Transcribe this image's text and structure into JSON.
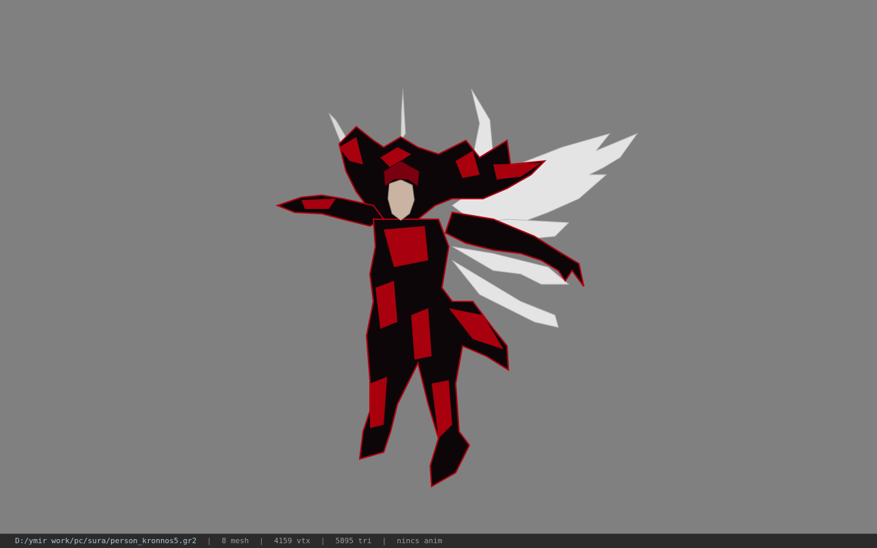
{
  "viewport": {
    "background_color": "#808080",
    "model_name": "person_kronnos5"
  },
  "status_bar": {
    "file_path": "D:/ymir work/pc/sura/person_kronnos5.gr2",
    "separator": "|",
    "mesh_count": "8 mesh",
    "vertex_count": "4159 vtx",
    "triangle_count": "5895 tri",
    "animation": "nincs anim",
    "background_color": "#2b2b2b",
    "path_color": "#a9c6d8"
  }
}
